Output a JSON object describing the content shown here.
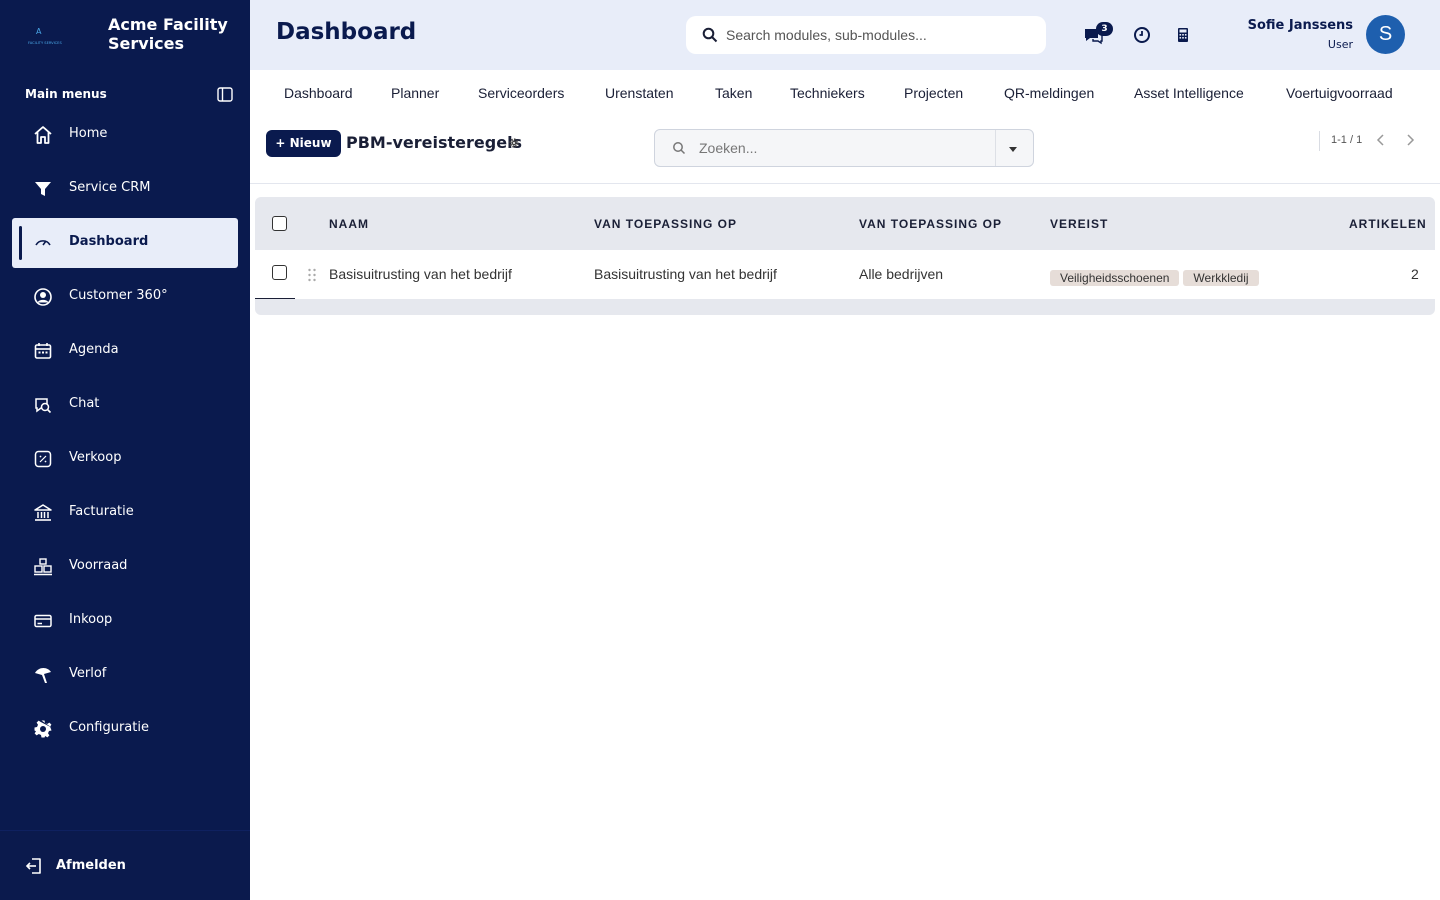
{
  "app": {
    "name": "Acme Facility Services",
    "logo_text": "FACILITY SERVICES"
  },
  "sidebar": {
    "heading": "Main menus",
    "items": [
      {
        "label": "Home",
        "icon": "home-icon",
        "active": false
      },
      {
        "label": "Service CRM",
        "icon": "funnel-icon",
        "active": false
      },
      {
        "label": "Dashboard",
        "icon": "gauge-icon",
        "active": true
      },
      {
        "label": "Customer 360°",
        "icon": "user-circle-icon",
        "active": false
      },
      {
        "label": "Agenda",
        "icon": "calendar-icon",
        "active": false
      },
      {
        "label": "Chat",
        "icon": "chat-search-icon",
        "active": false
      },
      {
        "label": "Verkoop",
        "icon": "percent-icon",
        "active": false
      },
      {
        "label": "Facturatie",
        "icon": "bank-icon",
        "active": false
      },
      {
        "label": "Voorraad",
        "icon": "inventory-icon",
        "active": false
      },
      {
        "label": "Inkoop",
        "icon": "card-icon",
        "active": false
      },
      {
        "label": "Verlof",
        "icon": "leave-icon",
        "active": false
      },
      {
        "label": "Configuratie",
        "icon": "gear-icon",
        "active": false
      }
    ],
    "logout_label": "Afmelden"
  },
  "header": {
    "title": "Dashboard",
    "search_placeholder": "Search modules, sub-modules...",
    "chat_count": "3",
    "user_name": "Sofie Janssens",
    "user_role": "User",
    "avatar_initial": "S"
  },
  "tabs": [
    "Dashboard",
    "Planner",
    "Serviceorders",
    "Urenstaten",
    "Taken",
    "Technieker­s",
    "Projecten",
    "QR-meldingen",
    "Asset Intelligence",
    "Voertuigvoorraad"
  ],
  "toolbar": {
    "new_label": "Nieuw",
    "list_title": "PBM-vereisteregels",
    "search_placeholder": "Zoeken...",
    "pager": "1-1 / 1"
  },
  "table": {
    "columns": [
      "NAAM",
      "VAN TOEPASSING OP",
      "VAN TOEPASSING OP",
      "VEREIST",
      "ARTIKELEN"
    ],
    "rows": [
      {
        "naam": "Basisuitrusting van het bedrijf",
        "toepassing1": "Basisuitrusting van het bedrijf",
        "toepassing2": "Alle bedrijven",
        "vereist": [
          "Veiligheidsschoenen",
          "Werkkledij"
        ],
        "artikelen": "2"
      }
    ]
  },
  "colors": {
    "navy": "#0a1a4e",
    "header_bg": "#e8edf9",
    "avatar": "#1e5fae",
    "tag_bg": "#e6ddd8"
  }
}
